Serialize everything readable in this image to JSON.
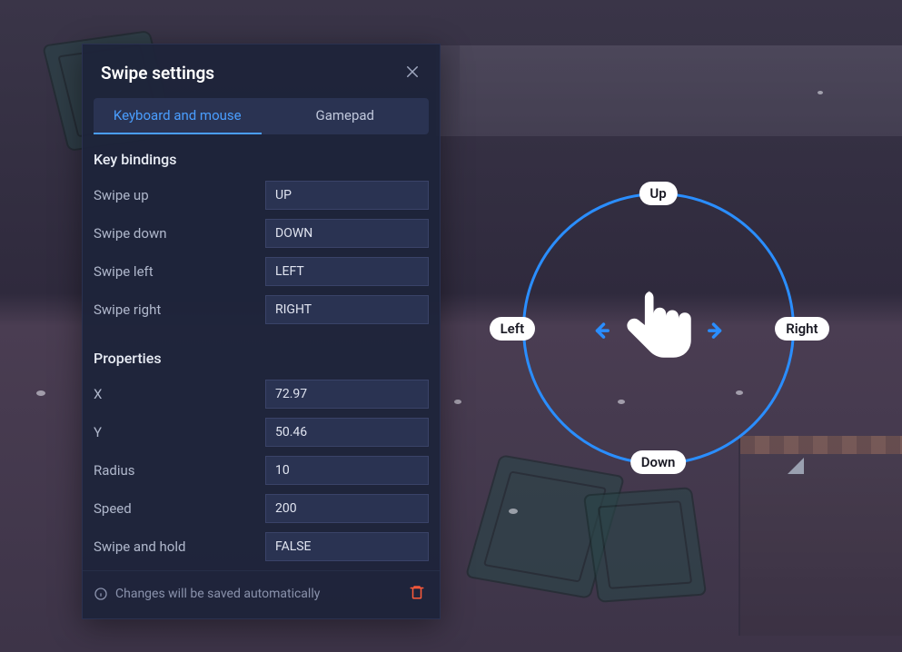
{
  "dialog": {
    "title": "Swipe settings",
    "tabs": {
      "keyboard": "Keyboard and mouse",
      "gamepad": "Gamepad",
      "active": "keyboard"
    },
    "sections": {
      "bindings": {
        "title": "Key bindings",
        "swipe_up": {
          "label": "Swipe up",
          "value": "UP"
        },
        "swipe_down": {
          "label": "Swipe down",
          "value": "DOWN"
        },
        "swipe_left": {
          "label": "Swipe left",
          "value": "LEFT"
        },
        "swipe_right": {
          "label": "Swipe right",
          "value": "RIGHT"
        }
      },
      "properties": {
        "title": "Properties",
        "x": {
          "label": "X",
          "value": "72.97"
        },
        "y": {
          "label": "Y",
          "value": "50.46"
        },
        "radius": {
          "label": "Radius",
          "value": "10"
        },
        "speed": {
          "label": "Speed",
          "value": "200"
        },
        "hold": {
          "label": "Swipe and hold",
          "value": "FALSE"
        }
      }
    },
    "footer_note": "Changes will be saved automatically"
  },
  "overlay": {
    "labels": {
      "up": "Up",
      "down": "Down",
      "left": "Left",
      "right": "Right"
    }
  },
  "colors": {
    "accent": "#2a8eff",
    "panel": "#1e243a",
    "input": "#2a3352",
    "danger": "#ff5a3a"
  }
}
